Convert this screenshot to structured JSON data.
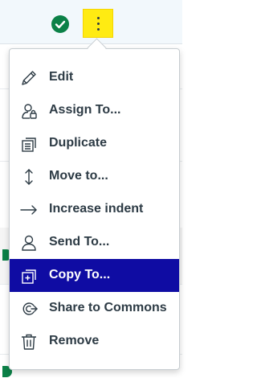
{
  "menu": {
    "items": [
      {
        "label": "Edit",
        "icon": "pencil-icon"
      },
      {
        "label": "Assign To...",
        "icon": "assign-user-icon"
      },
      {
        "label": "Duplicate",
        "icon": "duplicate-icon"
      },
      {
        "label": "Move to...",
        "icon": "move-arrows-icon"
      },
      {
        "label": "Increase indent",
        "icon": "indent-arrow-icon"
      },
      {
        "label": "Send To...",
        "icon": "send-user-icon"
      },
      {
        "label": "Copy To...",
        "icon": "copy-to-icon",
        "active": true
      },
      {
        "label": "Share to Commons",
        "icon": "share-commons-icon"
      },
      {
        "label": "Remove",
        "icon": "trash-icon"
      }
    ]
  },
  "colors": {
    "active_bg": "#0f0ca3",
    "text": "#2d3b45",
    "published_green": "#0b8147",
    "options_highlight": "#ffeb12"
  }
}
